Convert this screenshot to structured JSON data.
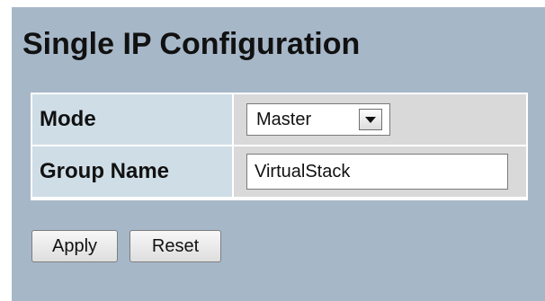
{
  "page": {
    "title": "Single IP Configuration"
  },
  "form": {
    "rows": [
      {
        "label": "Mode",
        "control": "select",
        "value": "Master",
        "options": [
          "Master"
        ]
      },
      {
        "label": "Group Name",
        "control": "text",
        "value": "VirtualStack"
      }
    ]
  },
  "buttons": {
    "apply_label": "Apply",
    "reset_label": "Reset"
  },
  "icons": {
    "mode_dropdown": "chevron-down-icon"
  },
  "colors": {
    "panel_background": "#a6b7c8",
    "label_cell_background": "#cfdde6",
    "value_cell_background": "#d9d9d9"
  }
}
